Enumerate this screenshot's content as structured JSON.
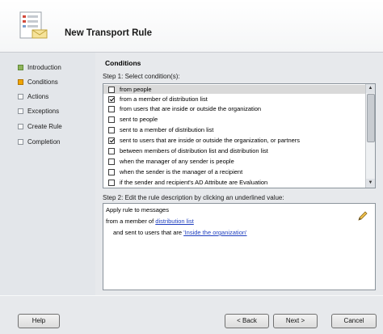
{
  "window": {
    "title": "New Transport Rule"
  },
  "nav": {
    "items": [
      {
        "label": "Introduction",
        "state": "done"
      },
      {
        "label": "Conditions",
        "state": "active"
      },
      {
        "label": "Actions",
        "state": "pending"
      },
      {
        "label": "Exceptions",
        "state": "pending"
      },
      {
        "label": "Create Rule",
        "state": "pending"
      },
      {
        "label": "Completion",
        "state": "pending"
      }
    ]
  },
  "main": {
    "section_title": "Conditions",
    "step1_label": "Step 1: Select condition(s):",
    "conditions": [
      {
        "label": "from people",
        "checked": false,
        "selected": true
      },
      {
        "label": "from a member of distribution list",
        "checked": true,
        "selected": false
      },
      {
        "label": "from users that are inside or outside the organization",
        "checked": false,
        "selected": false
      },
      {
        "label": "sent to people",
        "checked": false,
        "selected": false
      },
      {
        "label": "sent to a member of distribution list",
        "checked": false,
        "selected": false
      },
      {
        "label": "sent to users that are inside or outside the organization, or partners",
        "checked": true,
        "selected": false
      },
      {
        "label": "between members of distribution list and distribution list",
        "checked": false,
        "selected": false
      },
      {
        "label": "when the manager of any sender is people",
        "checked": false,
        "selected": false
      },
      {
        "label": "when the sender is the manager of a recipient",
        "checked": false,
        "selected": false
      },
      {
        "label": "if the sender and recipient's AD Attribute are Evaluation",
        "checked": false,
        "selected": false
      }
    ],
    "step2_label": "Step 2: Edit the rule description by clicking an underlined value:",
    "description": {
      "line1": "Apply rule to messages",
      "line2_prefix": "from a member of",
      "line2_link": "distribution list",
      "line3_prefix": "and sent to users that are",
      "line3_link": "'Inside the organization'"
    }
  },
  "footer": {
    "help_label": "Help",
    "back_label": "< Back",
    "next_label": "Next >",
    "cancel_label": "Cancel"
  },
  "colors": {
    "active_step": "#f0a500",
    "done_step": "#8fb45c",
    "link": "#1f3fbf"
  },
  "icons": {
    "header": "rule-wizard-icon",
    "edit": "pencil-icon"
  }
}
